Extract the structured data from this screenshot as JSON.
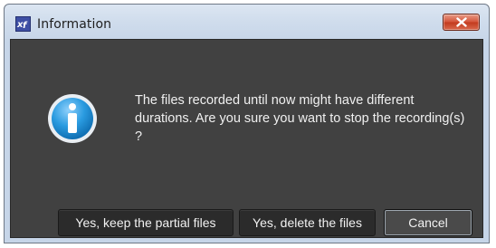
{
  "window": {
    "title": "Information",
    "app_icon": "app-logo-icon",
    "close_icon": "close-icon"
  },
  "dialog": {
    "icon": "info-icon",
    "message": "The files recorded until now might have different durations. Are you sure you want to stop the recording(s) ?"
  },
  "buttons": {
    "keep_label": "Yes, keep the partial files",
    "delete_label": "Yes, delete the files",
    "cancel_label": "Cancel"
  },
  "colors": {
    "dialog_background": "#414141",
    "close_button": "#c23a1e",
    "info_icon": "#1f8fd6"
  }
}
